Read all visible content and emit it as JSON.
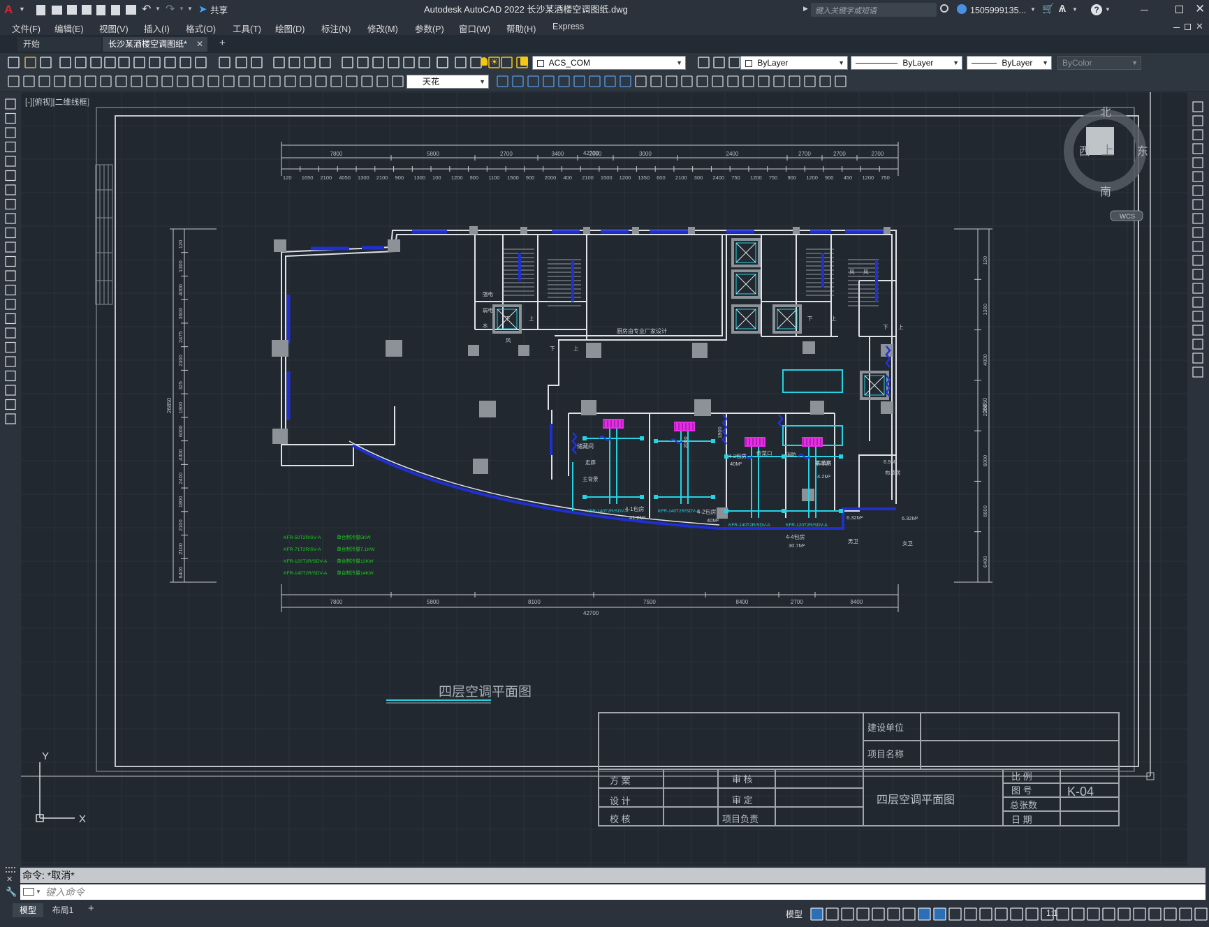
{
  "app": {
    "window_title": "Autodesk AutoCAD 2022    长沙某酒楼空调图纸.dwg",
    "search_placeholder": "键入关键字或短语",
    "user": "1505999135...",
    "share": "共享"
  },
  "menu": [
    "文件(F)",
    "编辑(E)",
    "视图(V)",
    "插入(I)",
    "格式(O)",
    "工具(T)",
    "绘图(D)",
    "标注(N)",
    "修改(M)",
    "参数(P)",
    "窗口(W)",
    "帮助(H)",
    "Express"
  ],
  "tabs": {
    "start": "开始",
    "active": "长沙某酒楼空调图纸*"
  },
  "toolbar": {
    "layer_current": "ACS_COM",
    "color": "ByLayer",
    "linetype": "ByLayer",
    "lineweight": "ByLayer",
    "plotstyle": "ByColor",
    "layer2": "天花"
  },
  "viewport": {
    "label": "[-][俯视][二维线框]",
    "viewcube": {
      "north": "北",
      "south": "南",
      "east": "东",
      "west": "西",
      "face": "上",
      "wcs": "WCS"
    },
    "ucs_x": "X",
    "ucs_y": "Y"
  },
  "drawing": {
    "title": "四层空调平面图",
    "overall_dim": "42700",
    "top_dims_row1": [
      "7800",
      "5800",
      "2700",
      "3400",
      "2000",
      "3000",
      "2400",
      "2700",
      "2700",
      "2700"
    ],
    "top_dims_row2": [
      "120",
      "1650",
      "2100",
      "4050",
      "1300",
      "2100",
      "900",
      "1300",
      "100",
      "1200",
      "900",
      "1100",
      "1500",
      "900",
      "2000",
      "400",
      "2100",
      "1500",
      "1200",
      "1350",
      "600",
      "2100",
      "300",
      "2400",
      "750",
      "1200",
      "750",
      "900",
      "1200",
      "900",
      "450",
      "1200",
      "750"
    ],
    "bottom_dims": [
      "7800",
      "5800",
      "8100",
      "7500",
      "8400",
      "2700",
      "8400"
    ],
    "left_dims_total": "26850",
    "right_dims_total": "26850",
    "left_dims": [
      "120",
      "1300",
      "4000",
      "3600",
      "2475",
      "2300",
      "325",
      "1800",
      "6000",
      "4300",
      "2400",
      "1800",
      "2100",
      "2100",
      "6400"
    ],
    "right_dims": [
      "120",
      "1300",
      "4000",
      "2300",
      "6000",
      "6600",
      "6400"
    ],
    "room_labels": {
      "kitchen_note": "厨房由专业厂家设计",
      "storage": "储藏间",
      "corridor": "走廊",
      "service": "备餐间",
      "main_stage": "主背景",
      "pass_room": "传菜口",
      "fire": "消防",
      "tea": "茶水间",
      "room1": "4-1包房",
      "room1_area": "41.2M²",
      "room2": "4-2包房",
      "room2_area": "40M²",
      "room3": "4-3包房",
      "room3_area": "40M²",
      "room4": "4-4包房",
      "room4_area": "30.7M²",
      "cleaning": "布草房",
      "cleaning_area": "4.2M²",
      "linen": "布草房",
      "linen_area": "6.9M²",
      "wc_men": "男卫",
      "wc_women": "女卫",
      "wc_area1": "6.32M²",
      "wc_area2": "6.32M²",
      "dim_2000": "2000",
      "dim_1800": "1800",
      "stair_down": "下",
      "stair_up": "上",
      "shaft_elec": "强电",
      "shaft_weak": "弱电",
      "shaft_water": "水",
      "shaft_wind": "风"
    },
    "unit_labels": [
      "KFR-140T2R/SDV-A",
      "KFR-140T2R/SDV-A",
      "KFR-140T2R/SDV-A",
      "KFR-120T2R/SDV-A"
    ],
    "legend": [
      {
        "model": "KFR-50T2R/SV-A",
        "desc": "单台制冷量5KW"
      },
      {
        "model": "KFR-71T2R/SV-A",
        "desc": "单台制冷量7.1KW"
      },
      {
        "model": "KFR-120T2R/SDV-A",
        "desc": "单台制冷量12KW"
      },
      {
        "model": "KFR-140T2R/SDV-A",
        "desc": "单台制冷量14KW"
      }
    ],
    "title_block": {
      "build_unit": "建设单位",
      "project_name": "项目名称",
      "scheme": "方 案",
      "review": "审 核",
      "design": "设 计",
      "approve": "审 定",
      "check": "校 核",
      "project_lead": "项目负责",
      "drawing_name": "四层空调平面图",
      "scale_label": "比 例",
      "number_label": "图 号",
      "number_value": "K-04",
      "sheets_label": "总张数",
      "date_label": "日 期"
    }
  },
  "command": {
    "history": "命令: *取消*",
    "prompt_placeholder": "键入命令"
  },
  "status": {
    "model_tab": "模型",
    "layout_tab": "布局1",
    "model_label": "模型",
    "scale": "1:1"
  }
}
